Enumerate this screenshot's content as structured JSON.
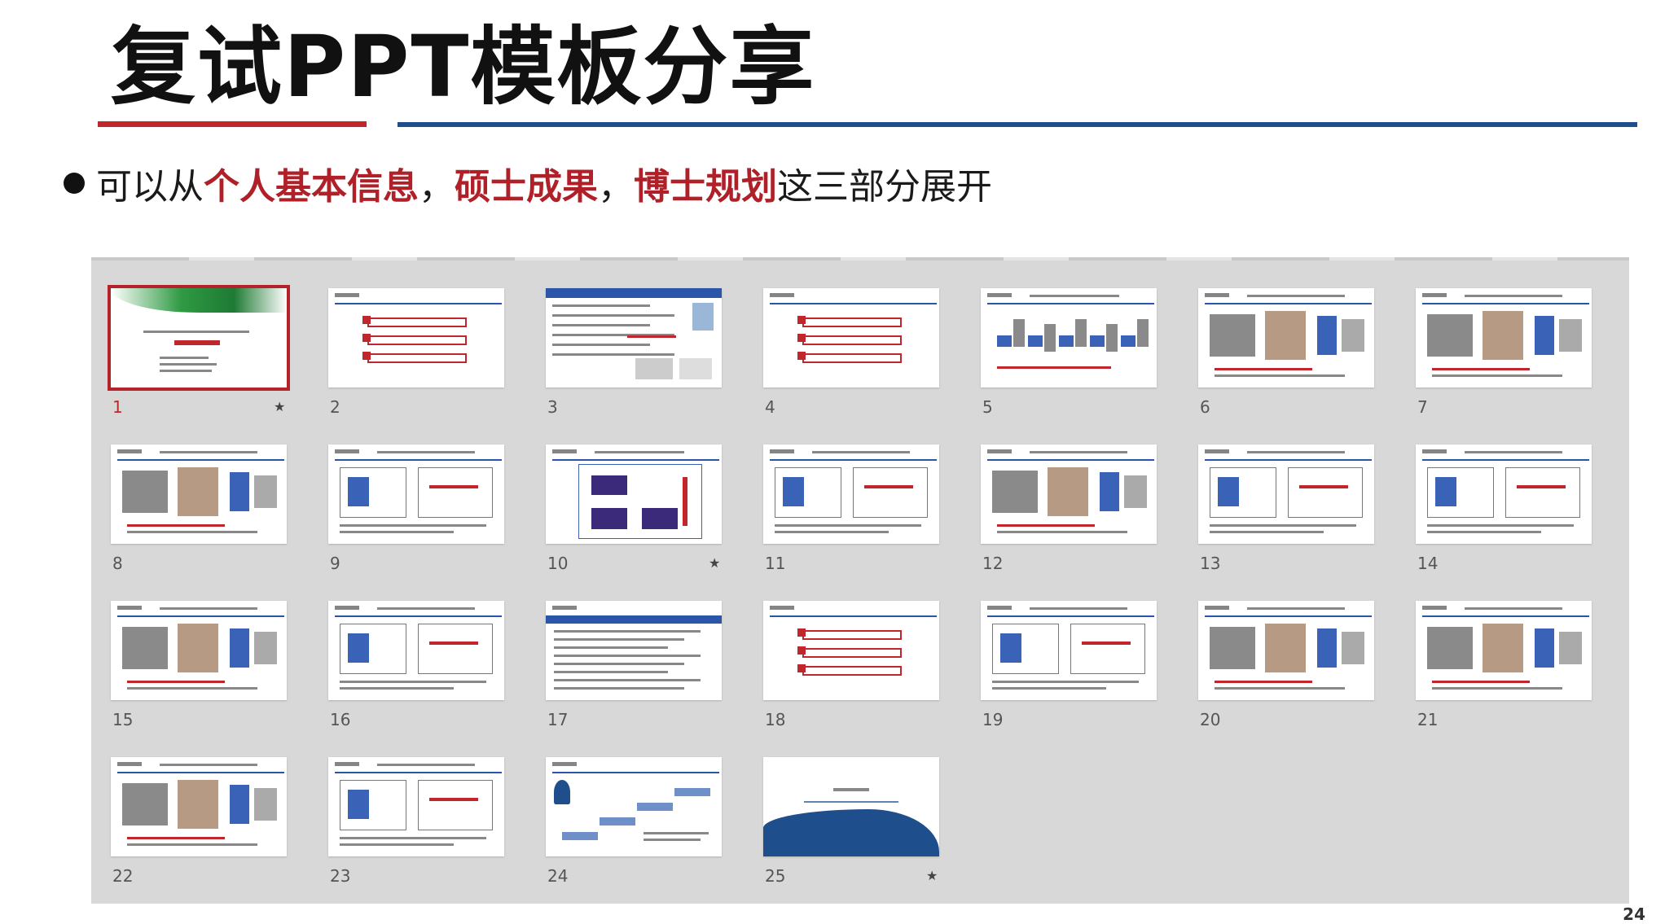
{
  "slide": {
    "title": "复试PPT模板分享",
    "bullet": {
      "prefix": "可以从",
      "hl1": "个人基本信息",
      "sep1": "，",
      "hl2": "硕士成果",
      "sep2": "，",
      "hl3": "博士规划",
      "suffix": "这三部分展开"
    },
    "page_number": "24"
  },
  "thumbnails": [
    {
      "n": "1",
      "star": true,
      "selected": true,
      "kind": "cover"
    },
    {
      "n": "2",
      "kind": "contents"
    },
    {
      "n": "3",
      "kind": "profile"
    },
    {
      "n": "4",
      "kind": "contents"
    },
    {
      "n": "5",
      "kind": "flow"
    },
    {
      "n": "6",
      "kind": "images"
    },
    {
      "n": "7",
      "kind": "images"
    },
    {
      "n": "8",
      "kind": "images"
    },
    {
      "n": "9",
      "kind": "diagram"
    },
    {
      "n": "10",
      "star": true,
      "kind": "grid"
    },
    {
      "n": "11",
      "kind": "diagram"
    },
    {
      "n": "12",
      "kind": "images"
    },
    {
      "n": "13",
      "kind": "diagram"
    },
    {
      "n": "14",
      "kind": "diagram"
    },
    {
      "n": "15",
      "kind": "images"
    },
    {
      "n": "16",
      "kind": "diagram"
    },
    {
      "n": "17",
      "kind": "text"
    },
    {
      "n": "18",
      "kind": "contents"
    },
    {
      "n": "19",
      "kind": "diagram"
    },
    {
      "n": "20",
      "kind": "images"
    },
    {
      "n": "21",
      "kind": "images"
    },
    {
      "n": "22",
      "kind": "images"
    },
    {
      "n": "23",
      "kind": "diagram"
    },
    {
      "n": "24",
      "kind": "steps"
    },
    {
      "n": "25",
      "star": true,
      "kind": "end"
    }
  ],
  "icons": {
    "star": "star-icon",
    "bullet": "bullet-dot-icon"
  },
  "colors": {
    "accent_red": "#c0272d",
    "accent_blue": "#1f4e8c"
  }
}
